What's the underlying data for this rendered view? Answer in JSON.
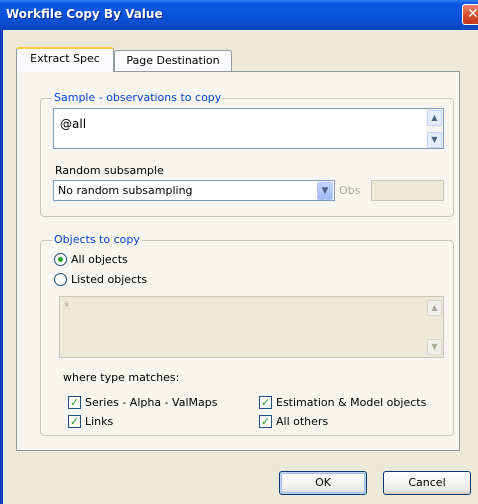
{
  "window": {
    "title": "Workfile Copy By Value",
    "close_glyph": "✕"
  },
  "tabs": [
    {
      "label": "Extract Spec",
      "active": true
    },
    {
      "label": "Page Destination",
      "active": false
    }
  ],
  "sample": {
    "legend": "Sample - observations to copy",
    "value": "@all",
    "random_label": "Random subsample",
    "random_selected": "No random subsampling",
    "obs_label": "Obs",
    "obs_value": ""
  },
  "objects": {
    "legend": "Objects to copy",
    "radio_all": "All objects",
    "radio_listed": "Listed objects",
    "listed_value": "*",
    "type_matches_label": "where type matches:",
    "checks": [
      {
        "label": "Series - Alpha - ValMaps",
        "checked": true
      },
      {
        "label": "Estimation & Model objects",
        "checked": true
      },
      {
        "label": "Links",
        "checked": true
      },
      {
        "label": "All others",
        "checked": true
      }
    ]
  },
  "buttons": {
    "ok": "OK",
    "cancel": "Cancel"
  },
  "icons": {
    "scroll_up": "▲",
    "scroll_down": "▼",
    "dropdown": "▼",
    "check": "✓"
  },
  "colors": {
    "title_bar": "#0A53D8",
    "group_legend": "#0046D5",
    "check_mark": "#21A121"
  }
}
